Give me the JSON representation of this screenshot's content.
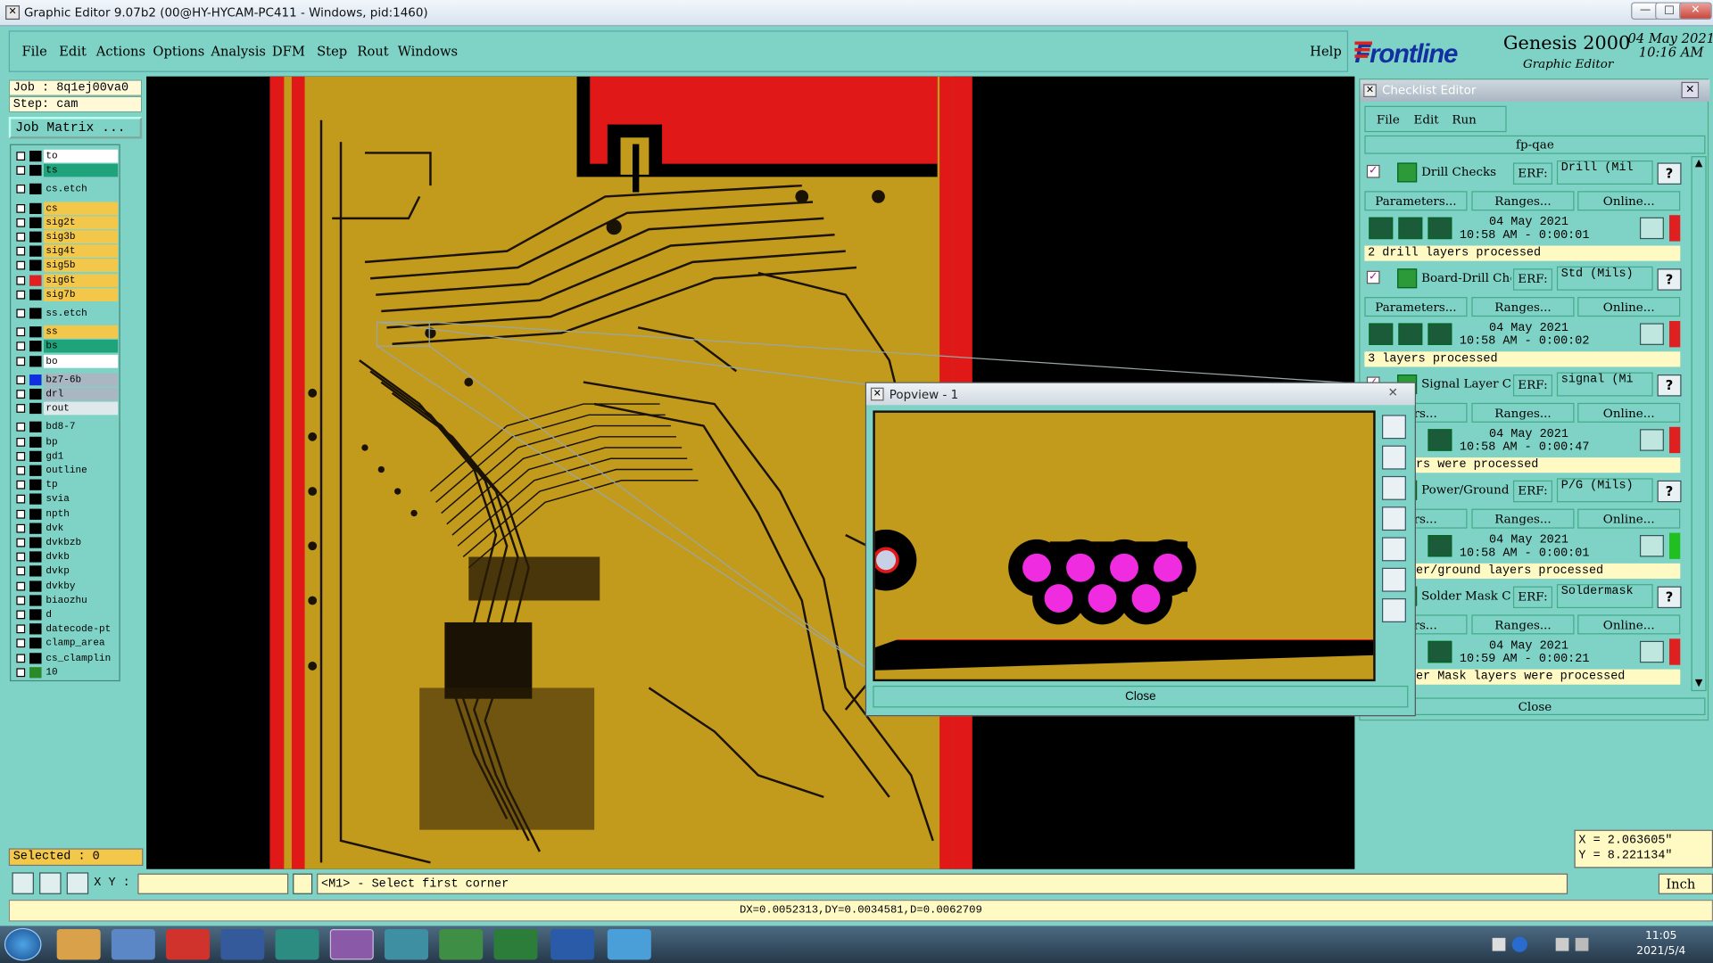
{
  "window": {
    "title": "Graphic Editor 9.07b2 (00@HY-HYCAM-PC411 - Windows, pid:1460)"
  },
  "menu": {
    "items": [
      "File",
      "Edit",
      "Actions",
      "Options",
      "Analysis",
      "DFM",
      "Step",
      "Rout",
      "Windows"
    ],
    "help": "Help"
  },
  "brand": {
    "logo": "Frontline",
    "product": "Genesis 2000",
    "subtitle": "Graphic Editor",
    "date": "04 May 2021",
    "time": "10:16 AM"
  },
  "job": {
    "job_label": "Job : 8q1ej00va0",
    "step_label": "Step: cam",
    "matrix_button": "Job Matrix ..."
  },
  "layers": [
    {
      "name": "to",
      "color": "#ffffff",
      "sel": "#000000"
    },
    {
      "name": "ts",
      "color": "#1fa37a",
      "sel": "#000000"
    },
    {
      "name": "cs.etch",
      "color": "#7fd3c6",
      "sel": "#000000"
    },
    {
      "name": "cs",
      "color": "#f3c84a",
      "sel": "#000000"
    },
    {
      "name": "sig2t",
      "color": "#f3c84a",
      "sel": "#000000"
    },
    {
      "name": "sig3b",
      "color": "#f3c84a",
      "sel": "#000000"
    },
    {
      "name": "sig4t",
      "color": "#f3c84a",
      "sel": "#000000"
    },
    {
      "name": "sig5b",
      "color": "#f3c84a",
      "sel": "#000000"
    },
    {
      "name": "sig6t",
      "color": "#f3c84a",
      "sel": "#e02020"
    },
    {
      "name": "sig7b",
      "color": "#f3c84a",
      "sel": "#000000"
    },
    {
      "name": "ss.etch",
      "color": "#7fd3c6",
      "sel": "#000000"
    },
    {
      "name": "ss",
      "color": "#f3c84a",
      "sel": "#000000"
    },
    {
      "name": "bs",
      "color": "#1fa37a",
      "sel": "#000000"
    },
    {
      "name": "bo",
      "color": "#ffffff",
      "sel": "#000000"
    },
    {
      "name": "bz7-6b",
      "color": "#a9b7c2",
      "sel": "#1030e0"
    },
    {
      "name": "drl",
      "color": "#a9b7c2",
      "sel": "#000000"
    },
    {
      "name": "rout",
      "color": "#dfe8ea",
      "sel": "#000000"
    },
    {
      "name": "bd8-7",
      "color": "#7fd3c6",
      "sel": "#000000"
    },
    {
      "name": "bp",
      "color": "#7fd3c6",
      "sel": "#000000"
    },
    {
      "name": "gd1",
      "color": "#7fd3c6",
      "sel": "#000000"
    },
    {
      "name": "outline",
      "color": "#7fd3c6",
      "sel": "#000000"
    },
    {
      "name": "tp",
      "color": "#7fd3c6",
      "sel": "#000000"
    },
    {
      "name": "svia",
      "color": "#7fd3c6",
      "sel": "#000000"
    },
    {
      "name": "npth",
      "color": "#7fd3c6",
      "sel": "#000000"
    },
    {
      "name": "dvk",
      "color": "#7fd3c6",
      "sel": "#000000"
    },
    {
      "name": "dvkbzb",
      "color": "#7fd3c6",
      "sel": "#000000"
    },
    {
      "name": "dvkb",
      "color": "#7fd3c6",
      "sel": "#000000"
    },
    {
      "name": "dvkp",
      "color": "#7fd3c6",
      "sel": "#000000"
    },
    {
      "name": "dvkby",
      "color": "#7fd3c6",
      "sel": "#000000"
    },
    {
      "name": "biaozhu",
      "color": "#7fd3c6",
      "sel": "#000000"
    },
    {
      "name": "d",
      "color": "#7fd3c6",
      "sel": "#000000"
    },
    {
      "name": "datecode-pt",
      "color": "#7fd3c6",
      "sel": "#000000"
    },
    {
      "name": "clamp_area",
      "color": "#7fd3c6",
      "sel": "#000000"
    },
    {
      "name": "cs_clamplin",
      "color": "#7fd3c6",
      "sel": "#000000"
    },
    {
      "name": "10",
      "color": "#7fd3c6",
      "sel": "#2a8a2a"
    }
  ],
  "selected": "Selected : 0",
  "checklist": {
    "title": "Checklist Editor",
    "menu": [
      "File",
      "Edit",
      "Run"
    ],
    "name": "fp-qae",
    "erf_label": "ERF:",
    "params": "Parameters...",
    "params_cut": "eters...",
    "ranges": "Ranges...",
    "online": "Online...",
    "close": "Close",
    "items": [
      {
        "name": "Drill Checks",
        "erf": "Drill (Mil",
        "date": "04 May 2021",
        "time": "10:58 AM - 0:00:01",
        "result": "2 drill layers processed",
        "flag": "#e02020"
      },
      {
        "name": "Board-Drill Che",
        "erf": "Std (Mils)",
        "date": "04 May 2021",
        "time": "10:58 AM - 0:00:02",
        "result": "3 layers processed",
        "flag": "#e02020"
      },
      {
        "name": "Signal Layer Ch",
        "erf": "signal (Mi",
        "date": "04 May 2021",
        "time": "10:58 AM - 0:00:47",
        "result": "rs were processed",
        "flag": "#e02020"
      },
      {
        "name": "Power/Ground C",
        "erf": "P/G (Mils)",
        "date": "04 May 2021",
        "time": "10:58 AM - 0:00:01",
        "result": "er/ground layers processed",
        "flag": "#20c020"
      },
      {
        "name": "Solder Mask Ch",
        "erf": "Soldermask",
        "date": "04 May 2021",
        "time": "10:59 AM - 0:00:21",
        "result": "er Mask layers were processed",
        "flag": "#e02020"
      }
    ]
  },
  "popview": {
    "title": "Popview - 1",
    "close": "Close"
  },
  "coords": {
    "x": "X = 2.063605\"",
    "y": "Y = 8.221134\""
  },
  "bottom": {
    "xy_label": "X Y :",
    "xy_value": "",
    "prompt": "<M1> - Select first corner",
    "units": "Inch"
  },
  "status": "DX=0.0052313,DY=0.0034581,D=0.0062709",
  "taskbar": {
    "time": "11:05",
    "date": "2021/5/4"
  }
}
